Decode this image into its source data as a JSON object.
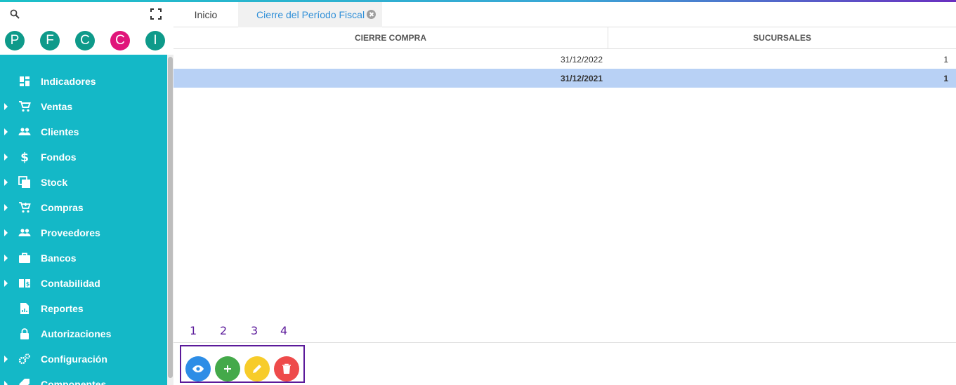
{
  "sidebar": {
    "avatars": [
      {
        "letter": "P",
        "color": "#0e9a8a"
      },
      {
        "letter": "F",
        "color": "#0e9a8a"
      },
      {
        "letter": "C",
        "color": "#0e9a8a"
      },
      {
        "letter": "C",
        "color": "#e0157a"
      },
      {
        "letter": "I",
        "color": "#0e9a8a"
      }
    ],
    "items": [
      {
        "label": "Indicadores",
        "icon": "dashboard-icon",
        "expandable": false
      },
      {
        "label": "Ventas",
        "icon": "cart-icon",
        "expandable": true
      },
      {
        "label": "Clientes",
        "icon": "people-icon",
        "expandable": true
      },
      {
        "label": "Fondos",
        "icon": "dollar-icon",
        "expandable": true
      },
      {
        "label": "Stock",
        "icon": "stock-icon",
        "expandable": true
      },
      {
        "label": "Compras",
        "icon": "add-cart-icon",
        "expandable": true
      },
      {
        "label": "Proveedores",
        "icon": "people-icon",
        "expandable": true
      },
      {
        "label": "Bancos",
        "icon": "briefcase-icon",
        "expandable": true
      },
      {
        "label": "Contabilidad",
        "icon": "ledger-icon",
        "expandable": true
      },
      {
        "label": "Reportes",
        "icon": "report-icon",
        "expandable": false
      },
      {
        "label": "Autorizaciones",
        "icon": "lock-icon",
        "expandable": false
      },
      {
        "label": "Configuración",
        "icon": "gears-icon",
        "expandable": true
      },
      {
        "label": "Componentes",
        "icon": "tag-icon",
        "expandable": true
      }
    ],
    "menu_color": "#14b8c7"
  },
  "tabs": [
    {
      "label": "Inicio"
    },
    {
      "label": "Cierre del Período Fiscal"
    }
  ],
  "grid": {
    "columns": [
      "CIERRE COMPRA",
      "SUCURSALES"
    ],
    "rows": [
      {
        "cierre": "31/12/2022",
        "sucursales": "1",
        "selected": false
      },
      {
        "cierre": "31/12/2021",
        "sucursales": "1",
        "selected": true
      }
    ]
  },
  "annotations": [
    "1",
    "2",
    "3",
    "4"
  ],
  "actions": [
    {
      "name": "view",
      "icon": "eye-icon",
      "color": "#2d8de6"
    },
    {
      "name": "add",
      "icon": "plus-icon",
      "color": "#44a94a"
    },
    {
      "name": "edit",
      "icon": "pencil-icon",
      "color": "#f7cc2a"
    },
    {
      "name": "delete",
      "icon": "trash-icon",
      "color": "#ee4b4b"
    }
  ]
}
